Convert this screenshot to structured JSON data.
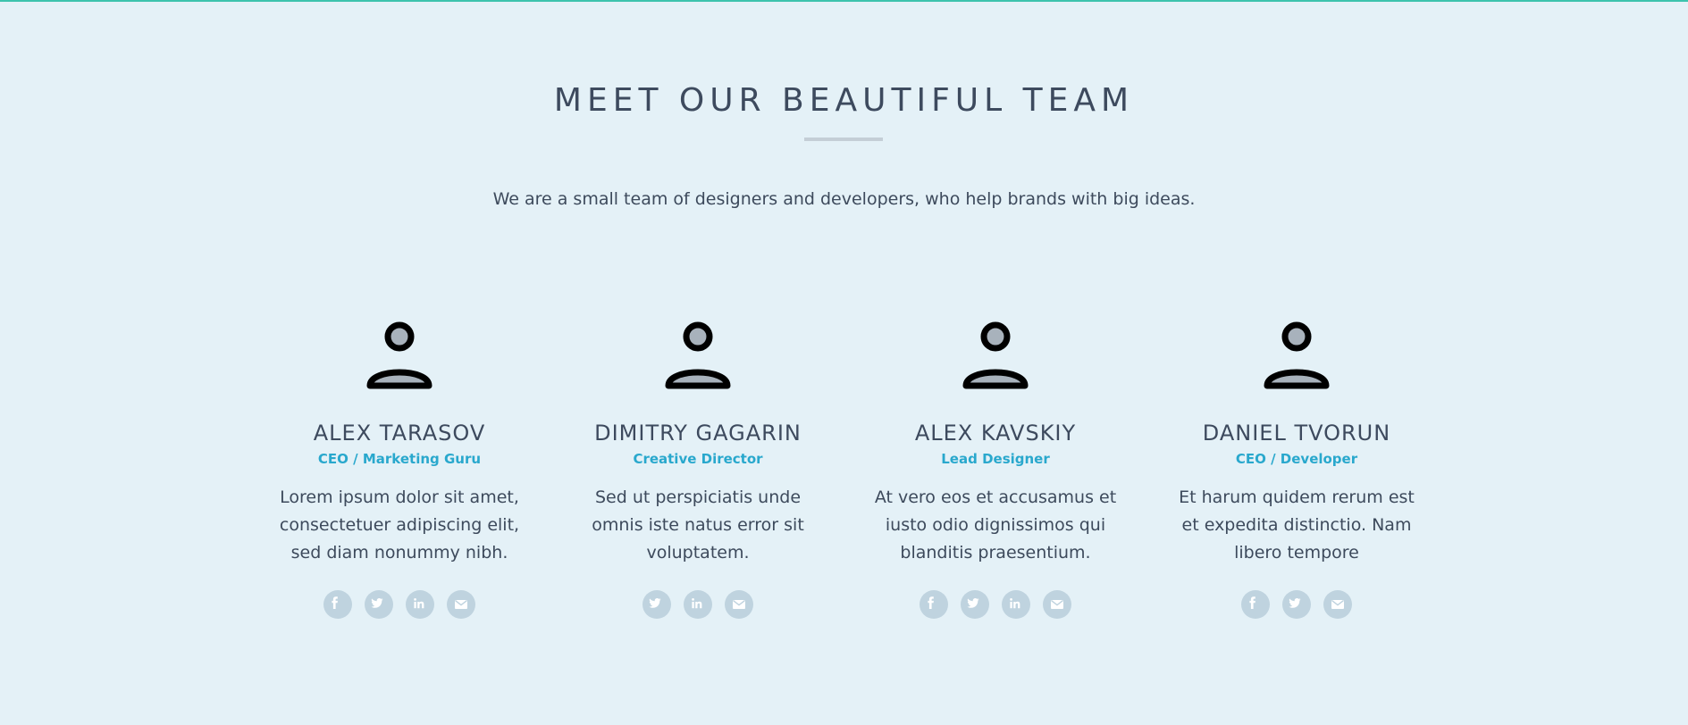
{
  "section": {
    "title": "MEET OUR BEAUTIFUL TEAM",
    "subtitle": "We are a small team of designers and developers, who help brands with big ideas."
  },
  "colors": {
    "background": "#e4f1f7",
    "accent": "#29a8cd",
    "top_line": "#3cc3ad",
    "text": "#3d4a5c",
    "social_bg": "#bfd3df"
  },
  "team": [
    {
      "name": "ALEX TARASOV",
      "role": "CEO / Marketing Guru",
      "bio": "Lorem ipsum dolor sit amet, consectetuer adipiscing elit, sed diam nonummy nibh.",
      "socials": [
        "facebook-icon",
        "twitter-icon",
        "linkedin-icon",
        "email-icon"
      ]
    },
    {
      "name": "DIMITRY GAGARIN",
      "role": "Creative Director",
      "bio": "Sed ut perspiciatis unde omnis iste natus error sit voluptatem.",
      "socials": [
        "twitter-icon",
        "linkedin-icon",
        "email-icon"
      ]
    },
    {
      "name": "ALEX KAVSKIY",
      "role": "Lead Designer",
      "bio": "At vero eos et accusamus et iusto odio dignissimos qui blanditis praesentium.",
      "socials": [
        "facebook-icon",
        "twitter-icon",
        "linkedin-icon",
        "email-icon"
      ]
    },
    {
      "name": "DANIEL TVORUN",
      "role": "CEO / Developer",
      "bio": "Et harum quidem rerum est et expedita distinctio. Nam libero tempore",
      "socials": [
        "facebook-icon",
        "twitter-icon",
        "email-icon"
      ]
    }
  ]
}
